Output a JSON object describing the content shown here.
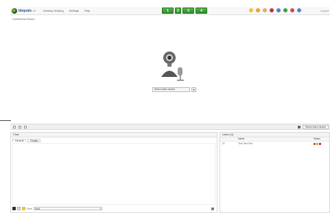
{
  "app": {
    "logo_text": "bbquals",
    "logo_version": "v3",
    "menu": [
      "Desktop Sharing",
      "Settings",
      "Help"
    ],
    "green_buttons": [
      "1",
      "2",
      "3",
      "4"
    ],
    "exit_label": "Logout",
    "subtitle": "Conference Room"
  },
  "video": {
    "select_label": "Select video device",
    "select_button": "▾"
  },
  "midbar": {
    "right_label": "Select video device"
  },
  "chat": {
    "title": "Chat",
    "tabs": [
      "General",
      "Private"
    ],
    "font_label": "Font:",
    "font_value": "Arial"
  },
  "users": {
    "title": "Users (1)",
    "columns": [
      "",
      "Name",
      "Status"
    ],
    "rows": [
      {
        "id": "01",
        "name": "Test Test Test"
      }
    ]
  },
  "colors": {
    "accent_green": "#2e8b2a",
    "link_blue": "#1d6fb0"
  }
}
